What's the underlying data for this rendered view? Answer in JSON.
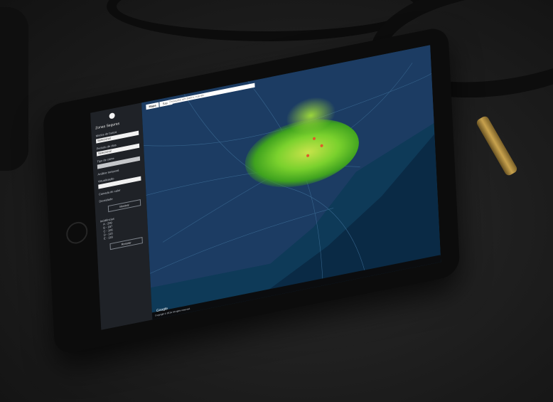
{
  "sidebar": {
    "title": "Zonas Seguras",
    "label_year": "Modos de busca",
    "select_value": "Selecionar",
    "label_type": "Período de dias",
    "select_type": "Selecionar",
    "label_crime": "Tipo de crime",
    "select_crime": "",
    "check_analysis": "Análise temporal",
    "check_visual": "Visualização",
    "select_visual": "",
    "check_radius": "Camada de calor",
    "check_density": "Densidade",
    "button_show": "Mostrar",
    "legend_title": "Incidências",
    "legend_items": [
      "A - 299",
      "B - 187",
      "C - 106",
      "D - 116",
      "E - 118"
    ],
    "button_reset": "Resetar"
  },
  "map": {
    "tabs": [
      "Mapa",
      "Satél."
    ],
    "search_placeholder": "Pesquise um bairro, rua etc",
    "google_label": "Google",
    "footer": "Copyright © 2018. All rights reserved."
  }
}
